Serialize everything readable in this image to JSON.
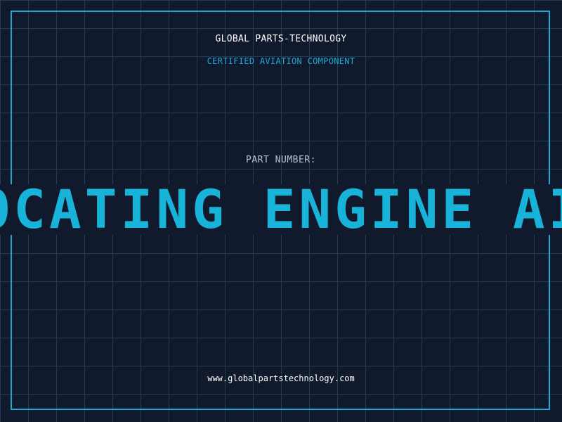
{
  "header": {
    "company": "GLOBAL PARTS-TECHNOLOGY",
    "subtitle": "CERTIFIED AVIATION COMPONENT"
  },
  "part": {
    "label": "PART NUMBER:",
    "value": "RECIPROCATING ENGINE AIRCRAFT"
  },
  "footer": {
    "website": "www.globalpartstechnology.com"
  },
  "colors": {
    "background": "#101a2c",
    "grid": "#1f3e55",
    "accent": "#1fa9d6",
    "part_text": "#17b3d8"
  }
}
